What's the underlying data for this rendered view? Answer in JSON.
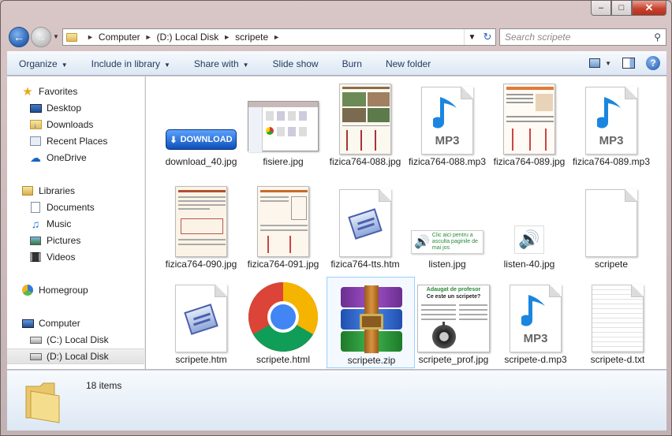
{
  "window": {
    "minimize_glyph": "–",
    "maximize_glyph": "□",
    "close_glyph": "✕"
  },
  "address": {
    "crumbs": [
      "Computer",
      "(D:) Local Disk",
      "scripete"
    ],
    "search_placeholder": "Search scripete"
  },
  "toolbar": {
    "items": [
      "Organize",
      "Include in library",
      "Share with",
      "Slide show",
      "Burn",
      "New folder"
    ]
  },
  "nav": {
    "favorites": "Favorites",
    "desktop": "Desktop",
    "downloads": "Downloads",
    "recent": "Recent Places",
    "onedrive": "OneDrive",
    "libraries": "Libraries",
    "documents": "Documents",
    "music": "Music",
    "pictures": "Pictures",
    "videos": "Videos",
    "homegroup": "Homegroup",
    "computer": "Computer",
    "c_drive": "(C:) Local Disk",
    "d_drive": "(D:) Local Disk"
  },
  "files": [
    {
      "name": "download_40.jpg",
      "kind": "download-button",
      "badge": "DOWNLOAD"
    },
    {
      "name": "fisiere.jpg",
      "kind": "screenshot"
    },
    {
      "name": "fizica764-088.jpg",
      "kind": "page-green"
    },
    {
      "name": "fizica764-088.mp3",
      "kind": "mp3",
      "label": "MP3"
    },
    {
      "name": "fizica764-089.jpg",
      "kind": "page-orange"
    },
    {
      "name": "fizica764-089.mp3",
      "kind": "mp3",
      "label": "MP3"
    },
    {
      "name": "fizica764-090.jpg",
      "kind": "page-beige"
    },
    {
      "name": "fizica764-091.jpg",
      "kind": "page-beige2"
    },
    {
      "name": "fizica764-tts.htm",
      "kind": "htm"
    },
    {
      "name": "listen.jpg",
      "kind": "listen-banner",
      "banner_text": "Clic aici pentru a asculta paginile de mai jos"
    },
    {
      "name": "listen-40.jpg",
      "kind": "listen-icon"
    },
    {
      "name": "scripete",
      "kind": "blank"
    },
    {
      "name": "scripete.htm",
      "kind": "htm"
    },
    {
      "name": "scripete.html",
      "kind": "chrome"
    },
    {
      "name": "scripete.zip",
      "kind": "zip"
    },
    {
      "name": "scripete_prof.jpg",
      "kind": "prof",
      "heading1": "Adaugat de profesor",
      "heading2": "Ce este un scripete?"
    },
    {
      "name": "scripete-d.mp3",
      "kind": "mp3",
      "label": "MP3"
    },
    {
      "name": "scripete-d.txt",
      "kind": "txt"
    }
  ],
  "status": {
    "count": "18 items"
  },
  "colors": {
    "accent": "#2b62b5",
    "toolbar_text": "#1e395b",
    "selection": "#99cfff"
  }
}
